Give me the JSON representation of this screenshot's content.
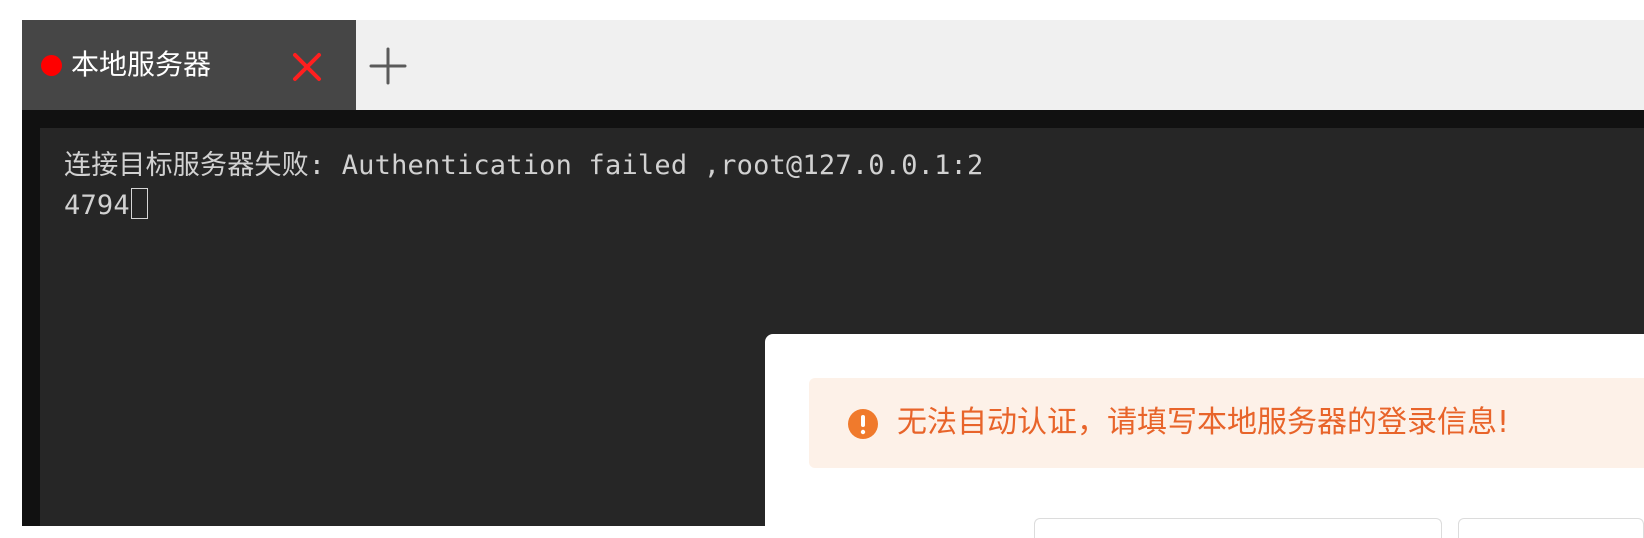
{
  "tabs": {
    "active_title": "本地服务器",
    "status_color": "#ff0000",
    "close_icon": "close-icon",
    "add_icon": "plus-icon"
  },
  "terminal": {
    "output": "连接目标服务器失败: Authentication failed ,root@127.0.0.1:24794"
  },
  "dialog": {
    "alert_text": "无法自动认证，请填写本地服务器的登录信息!",
    "alert_icon": "warning-icon",
    "alert_color": "#e8642a"
  }
}
